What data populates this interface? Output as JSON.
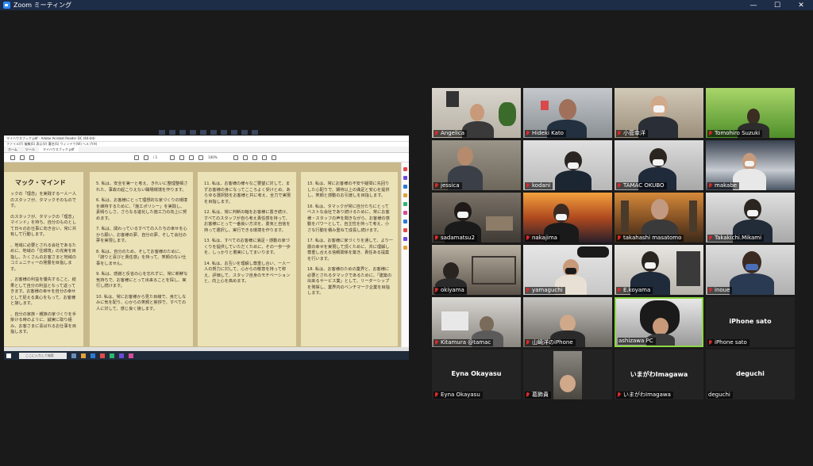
{
  "window": {
    "title": "Zoom ミーティング",
    "buttons": {
      "minimize": "—",
      "maximize": "☐",
      "close": "✕"
    }
  },
  "share": {
    "acrobat_title": "マイハウスブック.pdf - Adobe Acrobat Reader DC (64-bit)",
    "menu": "ファイル(F)  編集(E)  表示(V)  署名(S)  ウィンドウ(W)  ヘルプ(H)",
    "tabs": [
      "ホーム",
      "ツール",
      "マイハウスブック.pdf"
    ],
    "zoom_value": "100%",
    "page_value": "/ 1",
    "search_placeholder": "ここに入力して検索",
    "panel_heading": "マック・マインド",
    "left_panel_text": [
      "ックの「理念」を実践する一人一人のスタッフが、タマックそのものです。",
      "のスタッフが、タマックの「理念」マインド」を持ち、自分のものとして日々のお仕事に向き合い、常に共有して行動します。",
      "、地域に必要とされる会社であるために、地域の「住環境」の充実を目指し、たくさんのお客さまと地域のコミュニティーの発展を目指します。",
      "、お客様の利益を優先すること、結果として自分の利益となって返ってきます。お客様の幸せを自分の幸せとして捉える真心をもって、お客様と接します。",
      "、自分の家族・親族の家づくりを手掛ける時のように、誠実に取り組み、お客さまに喜ばれるお仕事を目指します。"
    ],
    "middle_panel_text": [
      "5. 私は、安全を第一と考え、きれいに整理整頓された、事故の起こりえない職場環境を作ります。",
      "6. 私は、お客様にとって理想的な家づくりの環境を維持するために、「施工ポリシー」を実践し、素晴らしさ、さらなる進化した施工力の向上に努めます。",
      "7. 私は、関わっているすべての人たちの幸せを心から願い、お客様の夢、自分の夢、そして会社の夢を実現します。",
      "8. 私は、自分のため、そしてお客様のために、「誇りと喜びと責任感」を持って、笑顔のない仕事をしません。",
      "9. 私は、感謝と反省の心を忘れずに、常に新鮮な気持ちで、お客様にとって出来ることを探し、実行し続けます。",
      "10. 私は、常にお客様から見た目線で、身だしなみに気を配り、心からの笑顔と挨拶で、すべての人に対して、感じ良く接します。"
    ],
    "right1_panel_text": [
      "11. 私は、お客様の様々なご要望に対して、まずお客様の身になってこころよく受けとめ、あらゆる選択肢をお客様と共に考え、全力で実現を目指します。",
      "12. 私は、常に判断の軸をお客様に置き続け、すべてのスタッフが自ら考え責任感を持って、お客様にとって一番良い方法を、勇気と自信を持って選択し、実行できる環境を作ります。",
      "13. 私は、すべてのお客様に満足・感動の家づくりを提供していただくために、その一歩一歩を、しっかりと着実にしてまいります。",
      "14. 私は、お互いを理解し尊重し合い、一人一人の努力に対して、心からの敬意を持って称え、評価して、スタッフ自身のモチベーションと、向上心を高めます。"
    ],
    "right2_panel_text": [
      "15. 私は、常にお客様の不安や疑問に先回りした心配りで、期待以上の満足と安心を提供し、笑顔と感動のお引渡しを目指します。",
      "16. 私は、タマックが常に自分たちにとってベストな会社であり続けるために、常にお客様・スタッフの声を聞きながら、お客様の感動をパワーとして、自主性を持って考え、小さな行動を積み重ねて成長し続けます。",
      "17. 私は、お客様に家づくりを通して、より一層の幸せを実現して頂くために、共に理解し尊重し合える信頼関係を築き、責任ある提案を行います。",
      "18. 私は、お客様のための業界と、お客様に必要とされるタマックであるために、「建築の出来るサービス業」として、リーダーシップを発揮し、業界内のベンチマーク企業を目指します。"
    ]
  },
  "participants": [
    {
      "name": "Angelica",
      "muted": true
    },
    {
      "name": "Hideki Kato",
      "muted": true
    },
    {
      "name": "小菅幸洋",
      "muted": true
    },
    {
      "name": "Tomohiro Suzuki",
      "muted": true
    },
    {
      "name": "jessica",
      "muted": true
    },
    {
      "name": "kodani",
      "muted": true
    },
    {
      "name": "TAMAC OKUBO",
      "muted": true
    },
    {
      "name": "makabe",
      "muted": true
    },
    {
      "name": "sadamatsu2",
      "muted": true
    },
    {
      "name": "nakajima",
      "muted": true
    },
    {
      "name": "takahashi masatomo",
      "muted": true
    },
    {
      "name": "Takakichi.Mikami",
      "muted": true
    },
    {
      "name": "okiyama",
      "muted": true
    },
    {
      "name": "yamaguchi",
      "muted": true
    },
    {
      "name": "E.koyama",
      "muted": true
    },
    {
      "name": "inoue",
      "muted": true
    },
    {
      "name": "Kitamura @tamac",
      "muted": true
    },
    {
      "name": "山崎洋のiPhone",
      "muted": true
    },
    {
      "name": "ashizawa PC",
      "muted": false
    },
    {
      "name": "iPhone sato",
      "muted": true,
      "display": "iPhone sato"
    },
    {
      "name": "Eyna Okayasu",
      "muted": true,
      "display": "Eyna Okayasu"
    },
    {
      "name": "葛飾貴",
      "muted": true
    },
    {
      "name": "いまがわImagawa",
      "muted": true,
      "display": "いまがわImagawa"
    },
    {
      "name": "deguchi",
      "muted": false,
      "display": "deguchi"
    }
  ]
}
